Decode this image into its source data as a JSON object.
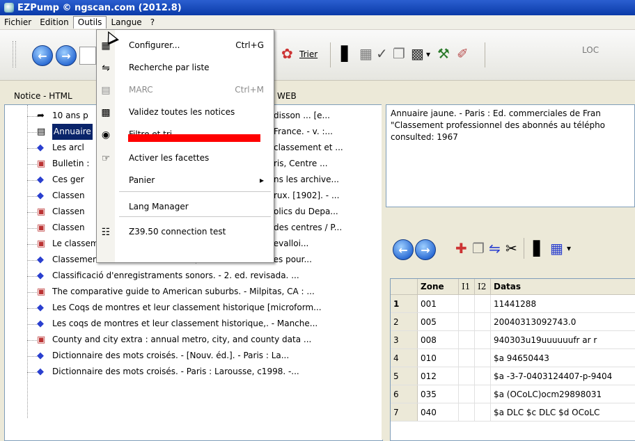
{
  "window": {
    "title": "EZPump © ngscan.com  (2012.8)"
  },
  "menubar": {
    "items": [
      "Fichier",
      "Edition",
      "Outils",
      "Langue",
      "?"
    ]
  },
  "toolbar": {
    "trier_label": "Trier",
    "loc_label": "LOC"
  },
  "tabs": {
    "left_label": "Notice - HTML",
    "web_label": "WEB"
  },
  "dropdown": {
    "items": [
      {
        "label": "Configurer...",
        "shortcut": "Ctrl+G",
        "icon": "qr-icon",
        "disabled": false
      },
      {
        "label": "Recherche par liste",
        "shortcut": "",
        "icon": "list-arrows-icon",
        "disabled": false
      },
      {
        "label": "MARC",
        "shortcut": "Ctrl+M",
        "icon": "document-icon",
        "disabled": true
      },
      {
        "label": "Validez toutes les notices",
        "shortcut": "",
        "icon": "book-validate-icon",
        "disabled": false
      },
      {
        "label": "Filtre et tri...",
        "shortcut": "",
        "icon": "filter-icon",
        "disabled": false
      },
      {
        "label": "Activer les facettes",
        "shortcut": "",
        "icon": "hand-facets-icon",
        "disabled": false
      },
      {
        "label": "Panier",
        "shortcut": "",
        "icon": "",
        "disabled": false,
        "submenu": true
      },
      {
        "label": "Lang Manager",
        "shortcut": "",
        "icon": "",
        "disabled": false
      },
      {
        "label": "Z39.50 connection test",
        "shortcut": "",
        "icon": "network-icon",
        "disabled": false
      }
    ]
  },
  "tree": {
    "items": [
      {
        "label": "10 ans p",
        "tail": "disson ... [e...",
        "icon": "link-icon"
      },
      {
        "label": "Annuaire",
        "tail": "France. - v. :...",
        "icon": "book-icon",
        "selected": true
      },
      {
        "label": "Les arcl",
        "tail": "classement et ...",
        "icon": "bookmark-icon"
      },
      {
        "label": "Bulletin :",
        "tail": "ris, Centre ...",
        "icon": "building-icon"
      },
      {
        "label": "Ces ger",
        "tail": "ns les archive...",
        "icon": "bookmark-icon"
      },
      {
        "label": "Classen",
        "tail": "rux. [1902]. - ...",
        "icon": "bookmark-icon"
      },
      {
        "label": "Classen",
        "tail": "olics du Depa...",
        "icon": "building-icon"
      },
      {
        "label": "Classen",
        "tail": "des centres / P...",
        "icon": "building-icon"
      },
      {
        "label": "Le classement ... des vins et domaines de France. - Levalloi...",
        "tail": "",
        "icon": "building-icon"
      },
      {
        "label": "Classement et matériel de bureau, notions essentielles pour...",
        "tail": "",
        "icon": "bookmark-icon"
      },
      {
        "label": "Classificació d'enregistraments sonors. - 2. ed. revisada. ...",
        "tail": "",
        "icon": "bookmark-icon"
      },
      {
        "label": "The comparative guide to American suburbs. - Milpitas, CA : ...",
        "tail": "",
        "icon": "building-icon"
      },
      {
        "label": "Les Coqs de montres et leur classement historique [microform...",
        "tail": "",
        "icon": "bookmark-icon"
      },
      {
        "label": "Les coqs de montres et leur classement historique,. - Manche...",
        "tail": "",
        "icon": "bookmark-icon"
      },
      {
        "label": "County and city extra : annual metro, city, and county data ...",
        "tail": "",
        "icon": "building-icon"
      },
      {
        "label": "Dictionnaire des mots croisés. - [Nouv. éd.]. - Paris : La...",
        "tail": "",
        "icon": "bookmark-icon"
      },
      {
        "label": "Dictionnaire des mots croisés. - Paris : Larousse, c1998. -...",
        "tail": "",
        "icon": "bookmark-icon"
      }
    ]
  },
  "notice": {
    "lines": [
      "Annuaire jaune. - Paris : Ed. commerciales de Fran",
      "\"Classement professionnel des abonnés au télépho",
      "consulted: 1967"
    ]
  },
  "grid": {
    "headers": [
      "",
      "Zone",
      "I1",
      "I2",
      "Datas"
    ],
    "rows": [
      [
        "1",
        "001",
        "",
        "",
        "11441288"
      ],
      [
        "2",
        "005",
        "",
        "",
        "20040313092743.0"
      ],
      [
        "3",
        "008",
        "",
        "",
        "940303u19uuuuuufr ar   r"
      ],
      [
        "4",
        "010",
        "",
        "",
        "$a   94650443"
      ],
      [
        "5",
        "012",
        "",
        "",
        "$a -3-7-0403124407-p-9404"
      ],
      [
        "6",
        "035",
        "",
        "",
        "$a (OCoLC)ocm29898031"
      ],
      [
        "7",
        "040",
        "",
        "",
        "$a DLC $c DLC $d OCoLC"
      ]
    ]
  }
}
